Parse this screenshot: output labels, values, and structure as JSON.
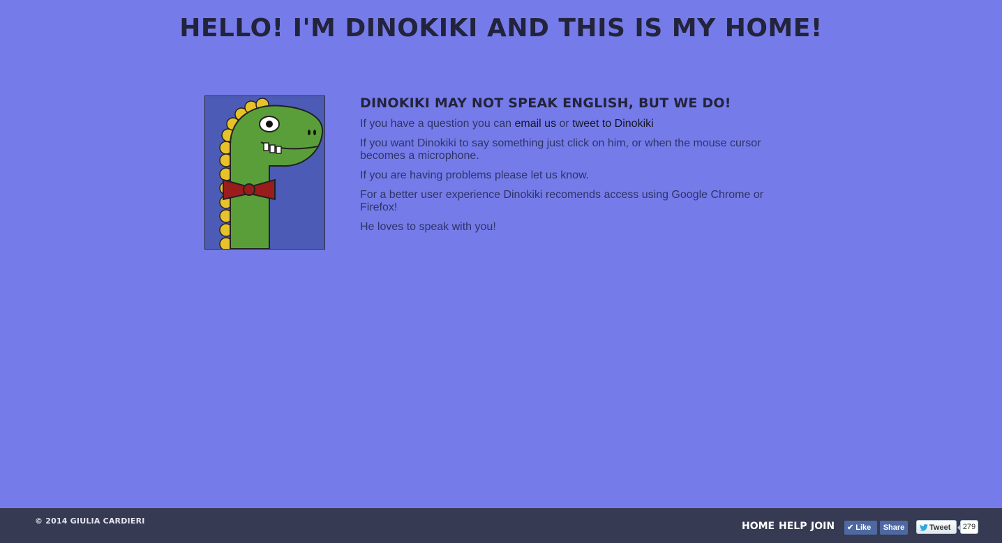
{
  "header": {
    "title": "HELLO! I'M DINOKIKI AND THIS IS MY HOME!"
  },
  "main": {
    "subtitle": "DINOKIKI MAY NOT SPEAK ENGLISH, BUT WE DO!",
    "para1_prefix": "If you have a question you can ",
    "email_link": "email us",
    "para1_mid": " or ",
    "tweet_link": "tweet to Dinokiki",
    "para2": "If you want Dinokiki to say something just click on him, or when the mouse cursor becomes a microphone.",
    "para3": "If you are having problems please let us know.",
    "para4": "For a better user experience Dinokiki recomends access using Google Chrome or Firefox!",
    "para5": "He loves to speak with you!"
  },
  "footer": {
    "copyright": "© 2014 GIULIA CARDIERI",
    "nav": [
      "HOME",
      "HELP",
      "JOIN"
    ],
    "fb_like": "Like",
    "fb_share": "Share",
    "tweet": "Tweet",
    "tweet_count": "279"
  },
  "colors": {
    "background": "#757ce9",
    "footer": "#363a52",
    "dino_green": "#5a9e3a",
    "bowtie": "#9b1c1c",
    "spikes": "#e8c22b"
  }
}
